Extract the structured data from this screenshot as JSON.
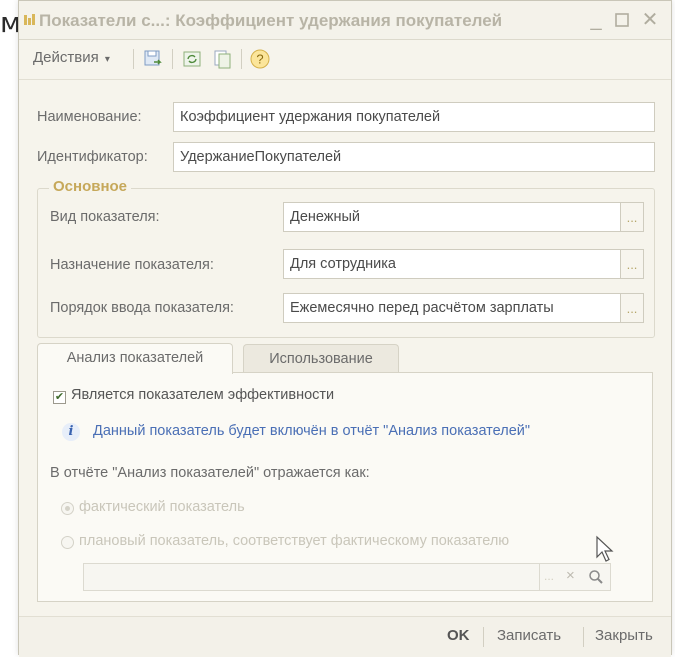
{
  "background_fragment": "ми",
  "window": {
    "title": "Показатели с...: Коэффициент удержания покупателей"
  },
  "toolbar": {
    "actions_label": "Действия",
    "icons": [
      "save-and-close-icon",
      "refresh-icon",
      "copy-icon",
      "help-icon"
    ]
  },
  "fields": {
    "name_label": "Наименование:",
    "name_value": "Коэффициент удержания покупателей",
    "id_label": "Идентификатор:",
    "id_value": "УдержаниеПокупателей"
  },
  "main_group": {
    "title": "Основное",
    "type_label": "Вид показателя:",
    "type_value": "Денежный",
    "purpose_label": "Назначение показателя:",
    "purpose_value": "Для сотрудника",
    "order_label": "Порядок ввода показателя:",
    "order_value": "Ежемесячно перед расчётом зарплаты",
    "select_btn": "..."
  },
  "tabs": [
    {
      "label": "Анализ показателей",
      "active": true
    },
    {
      "label": "Использование",
      "active": false
    }
  ],
  "analysis": {
    "kpi_checkbox_label": "Является показателем эффективности",
    "kpi_checked": true,
    "info_text": "Данный показатель будет включён в отчёт \"Анализ показателей\"",
    "report_label": "В отчёте \"Анализ показателей\" отражается как:",
    "radio_actual": "фактический показатель",
    "radio_planned": "плановый показатель, соответствует фактическому показателю",
    "selected_radio": "actual",
    "actual_input_value": "",
    "input_btn_select": "...",
    "input_btn_clear": "×"
  },
  "footer": {
    "ok_label": "OK",
    "save_label": "Записать",
    "close_label": "Закрыть"
  },
  "colors": {
    "window_bg": "#f6f4ec",
    "group_title": "#c6a85a",
    "info_text": "#4a6fb5"
  }
}
